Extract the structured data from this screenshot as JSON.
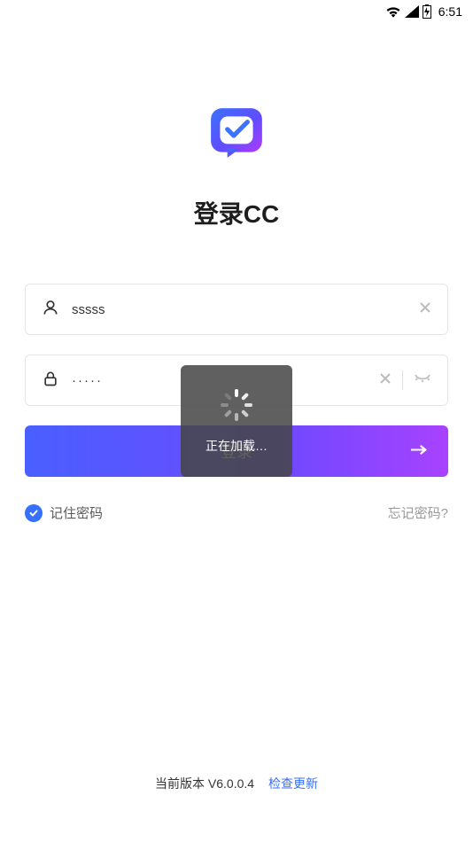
{
  "status": {
    "time": "6:51"
  },
  "title": "登录CC",
  "fields": {
    "username": {
      "value": "sssss"
    },
    "password": {
      "value": "·····"
    }
  },
  "login_button": "登录",
  "remember_label": "记住密码",
  "forgot_label": "忘记密码?",
  "overlay_text": "正在加载…",
  "footer": {
    "version_label": "当前版本 V6.0.0.4",
    "check_update": "检查更新"
  }
}
